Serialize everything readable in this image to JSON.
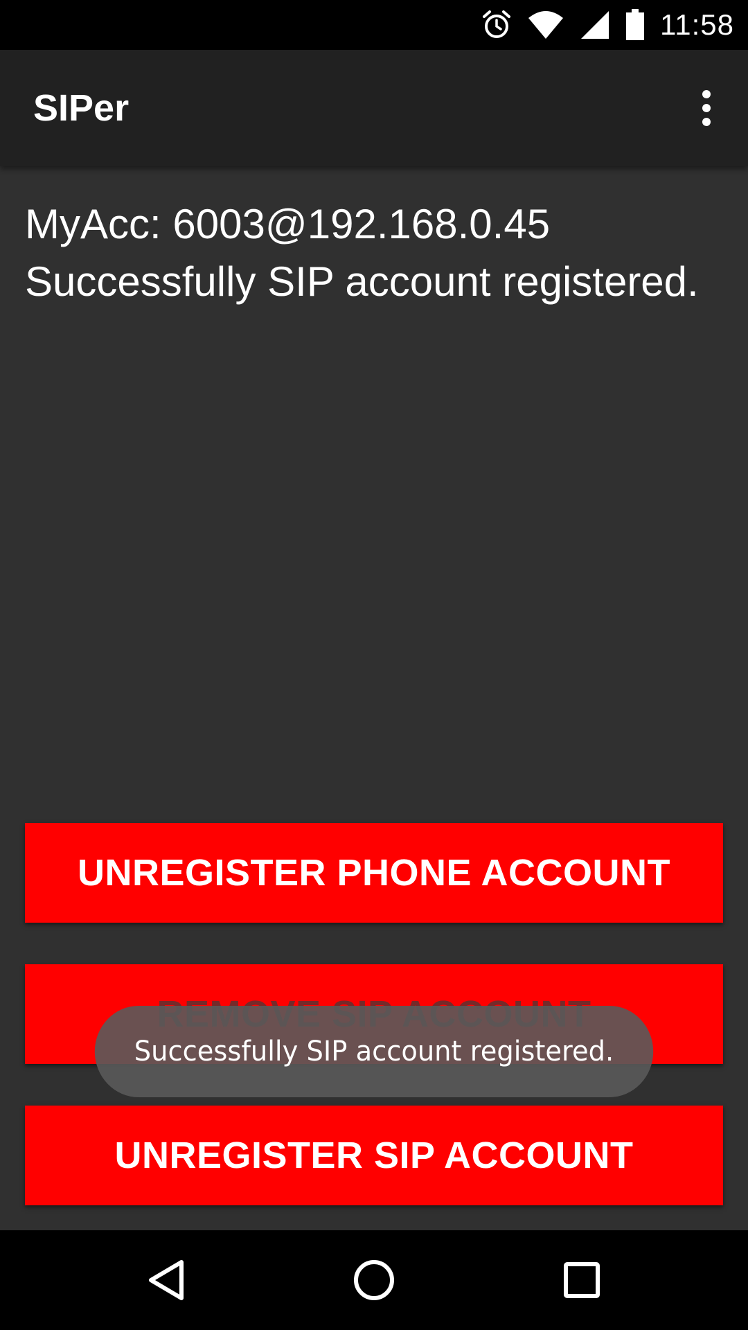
{
  "status_bar": {
    "time": "11:58",
    "icons": [
      "alarm-icon",
      "wifi-icon",
      "cell-signal-icon",
      "battery-icon"
    ]
  },
  "app_bar": {
    "title": "SIPer",
    "menu_icon": "overflow-menu-icon"
  },
  "content": {
    "account_line": "MyAcc: 6003@192.168.0.45",
    "status_message": "Successfully SIP account registered."
  },
  "buttons": {
    "unregister_phone": "UNREGISTER PHONE ACCOUNT",
    "remove_sip": "REMOVE SIP ACCOUNT",
    "unregister_sip": "UNREGISTER SIP ACCOUNT"
  },
  "toast": {
    "message": "Successfully SIP account registered."
  },
  "nav_bar": {
    "icons": [
      "back-icon",
      "home-icon",
      "recents-icon"
    ]
  },
  "colors": {
    "button_red": "#ff0000",
    "background": "#303030",
    "app_bar": "#212121"
  }
}
